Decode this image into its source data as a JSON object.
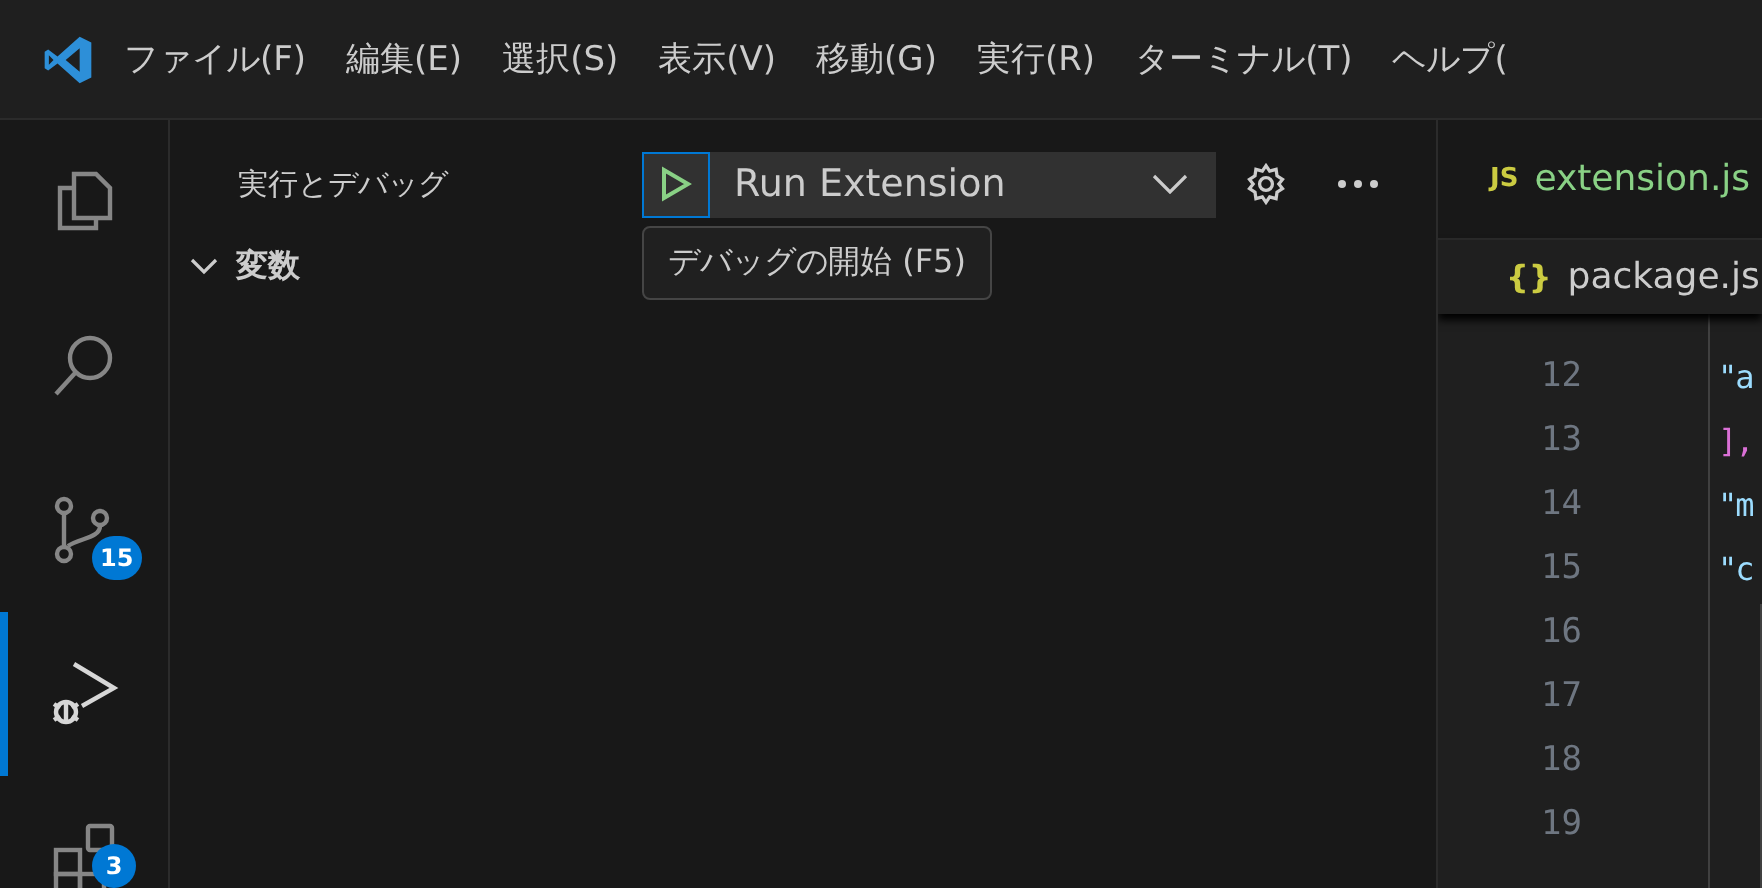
{
  "menu": [
    "ファイル(F)",
    "編集(E)",
    "選択(S)",
    "表示(V)",
    "移動(G)",
    "実行(R)",
    "ターミナル(T)",
    "ヘルプ("
  ],
  "activity_bar": [
    {
      "kind": "explorer",
      "selected": false
    },
    {
      "kind": "search",
      "selected": false
    },
    {
      "kind": "source_control",
      "selected": false,
      "badge": "15"
    },
    {
      "kind": "run_debug",
      "selected": true
    },
    {
      "kind": "extensions",
      "selected": false,
      "badge": "3"
    }
  ],
  "sidebar": {
    "title": "実行とデバッグ",
    "launch_config": "Run Extension",
    "tooltip": "デバッグの開始 (F5)",
    "sections": [
      {
        "label": "変数",
        "expanded": true
      }
    ]
  },
  "editor": {
    "tabs": [
      {
        "icon": "JS",
        "label": "extension.js",
        "kind": "js"
      },
      {
        "icon": "{}",
        "label": "package.js",
        "kind": "json"
      }
    ],
    "lines": [
      {
        "number": "12",
        "tokens": [
          {
            "text": "\"a",
            "kind": "string"
          }
        ]
      },
      {
        "number": "13",
        "tokens": [
          {
            "text": "],",
            "kind": "bracket"
          }
        ]
      },
      {
        "number": "14",
        "tokens": [
          {
            "text": "\"m",
            "kind": "string"
          }
        ]
      },
      {
        "number": "15",
        "tokens": [
          {
            "text": "\"c",
            "kind": "string"
          }
        ]
      },
      {
        "number": "16"
      },
      {
        "number": "17"
      },
      {
        "number": "18"
      },
      {
        "number": "19"
      }
    ]
  }
}
